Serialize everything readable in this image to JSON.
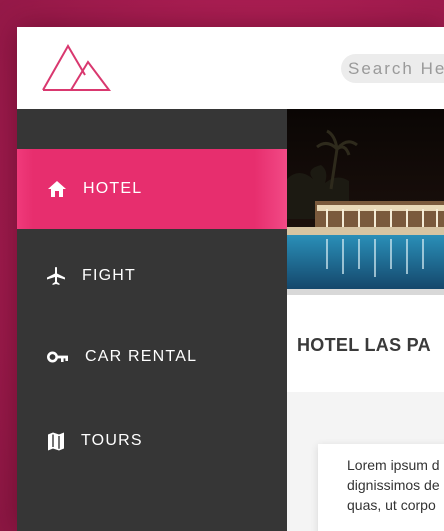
{
  "search": {
    "placeholder": "Search He"
  },
  "sidebar": {
    "items": [
      {
        "label": "HOTEL",
        "icon": "home-icon",
        "active": true
      },
      {
        "label": "FIGHT",
        "icon": "airplane-icon",
        "active": false
      },
      {
        "label": "CAR RENTAL",
        "icon": "key-icon",
        "active": false
      },
      {
        "label": "TOURS",
        "icon": "map-icon",
        "active": false
      }
    ]
  },
  "main": {
    "title": "HOTEL LAS PA",
    "body_text": "Lorem ipsum d\ndignissimos de\nquas, ut corpo"
  },
  "colors": {
    "accent": "#e72e6e",
    "sidebar_bg": "#363636",
    "background": "#a51c50"
  }
}
